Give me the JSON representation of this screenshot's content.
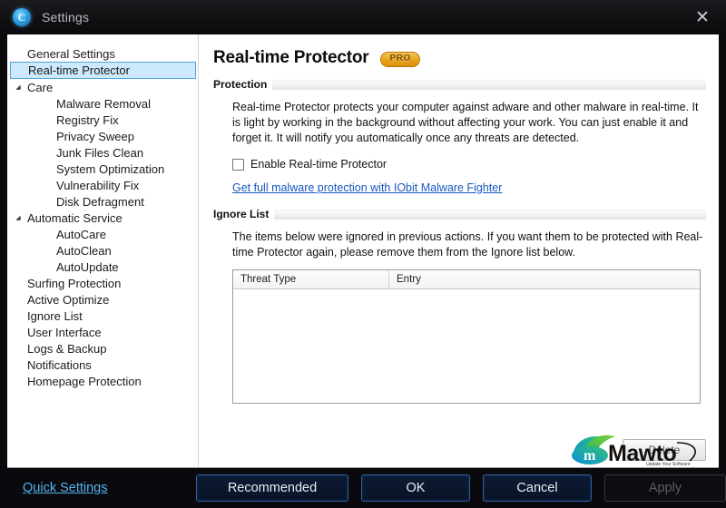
{
  "window": {
    "title": "Settings",
    "icon": "app-logo-icon",
    "close_label": "✕"
  },
  "sidebar": {
    "items": [
      {
        "label": "General Settings",
        "level": 0,
        "arrow": "",
        "selected": false
      },
      {
        "label": "Real-time Protector",
        "level": 0,
        "arrow": "",
        "selected": true
      },
      {
        "label": "Care",
        "level": 0,
        "arrow": "◢",
        "selected": false
      },
      {
        "label": "Malware Removal",
        "level": 1,
        "arrow": "",
        "selected": false
      },
      {
        "label": "Registry Fix",
        "level": 1,
        "arrow": "",
        "selected": false
      },
      {
        "label": "Privacy Sweep",
        "level": 1,
        "arrow": "",
        "selected": false
      },
      {
        "label": "Junk Files Clean",
        "level": 1,
        "arrow": "",
        "selected": false
      },
      {
        "label": "System Optimization",
        "level": 1,
        "arrow": "",
        "selected": false
      },
      {
        "label": "Vulnerability Fix",
        "level": 1,
        "arrow": "",
        "selected": false
      },
      {
        "label": "Disk Defragment",
        "level": 1,
        "arrow": "",
        "selected": false
      },
      {
        "label": "Automatic Service",
        "level": 0,
        "arrow": "◢",
        "selected": false
      },
      {
        "label": "AutoCare",
        "level": 1,
        "arrow": "",
        "selected": false
      },
      {
        "label": "AutoClean",
        "level": 1,
        "arrow": "",
        "selected": false
      },
      {
        "label": "AutoUpdate",
        "level": 1,
        "arrow": "",
        "selected": false
      },
      {
        "label": "Surfing Protection",
        "level": 0,
        "arrow": "",
        "selected": false
      },
      {
        "label": "Active Optimize",
        "level": 0,
        "arrow": "",
        "selected": false
      },
      {
        "label": "Ignore List",
        "level": 0,
        "arrow": "",
        "selected": false
      },
      {
        "label": "User Interface",
        "level": 0,
        "arrow": "",
        "selected": false
      },
      {
        "label": "Logs & Backup",
        "level": 0,
        "arrow": "",
        "selected": false
      },
      {
        "label": "Notifications",
        "level": 0,
        "arrow": "",
        "selected": false
      },
      {
        "label": "Homepage Protection",
        "level": 0,
        "arrow": "",
        "selected": false
      }
    ]
  },
  "main": {
    "title": "Real-time Protector",
    "badge": "PRO",
    "protection": {
      "group_title": "Protection",
      "description": "Real-time Protector protects your computer against adware and other malware in real-time. It is light by working in the background without affecting your work. You can just enable it and forget it. It will notify you automatically once any threats are detected.",
      "checkbox_label": "Enable Real-time Protector",
      "checkbox_checked": false,
      "link_text": "Get full malware protection with IObit Malware Fighter"
    },
    "ignore_list": {
      "group_title": "Ignore List",
      "description": "The items below were ignored in previous actions. If you want them to be protected with Real-time Protector again, please remove them from the Ignore list below.",
      "columns": [
        "Threat Type",
        "Entry"
      ],
      "rows": [],
      "delete_label": "Delete"
    }
  },
  "watermark": {
    "name": "Mawto",
    "tagline": "Update Your Software"
  },
  "footer": {
    "quick_settings": "Quick Settings",
    "buttons": [
      {
        "label": "Recommended",
        "state": "enabled"
      },
      {
        "label": "OK",
        "state": "enabled"
      },
      {
        "label": "Cancel",
        "state": "enabled"
      },
      {
        "label": "Apply",
        "state": "disabled"
      }
    ]
  },
  "colors": {
    "accent_blue": "#53b4ee",
    "link_blue": "#1758c0",
    "selection_bg": "#cdeafc",
    "selection_border": "#4ea3e0",
    "pro_gold": "#e9a317",
    "chrome_dark": "#0a0a0e"
  }
}
